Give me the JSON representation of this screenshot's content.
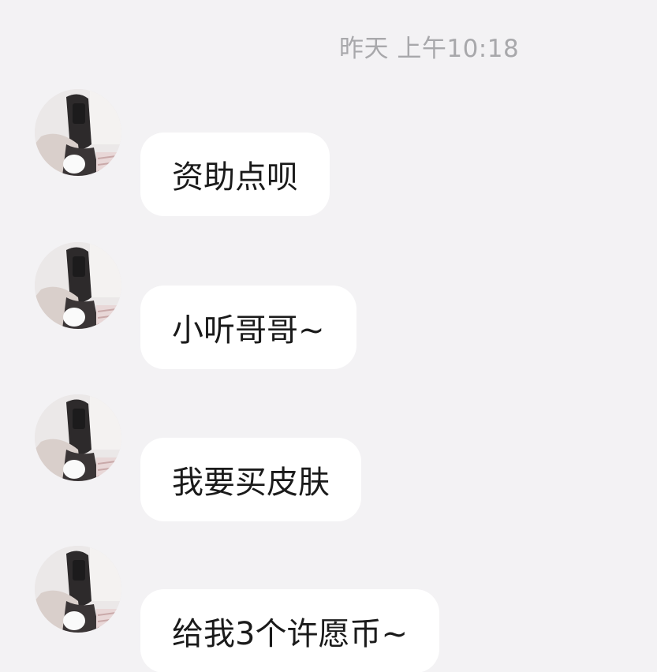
{
  "timestamp": "昨天 上午10:18",
  "messages": [
    {
      "text": "资助点呗"
    },
    {
      "text": "小听哥哥~"
    },
    {
      "text": "我要买皮肤"
    },
    {
      "text": "给我3个许愿币~"
    }
  ],
  "avatar": {
    "icon": "profile-photo-icon"
  },
  "colors": {
    "background": "#f3f2f4",
    "bubble": "#ffffff",
    "timestamp": "#a8a8ab",
    "text": "#1a1a1a"
  }
}
